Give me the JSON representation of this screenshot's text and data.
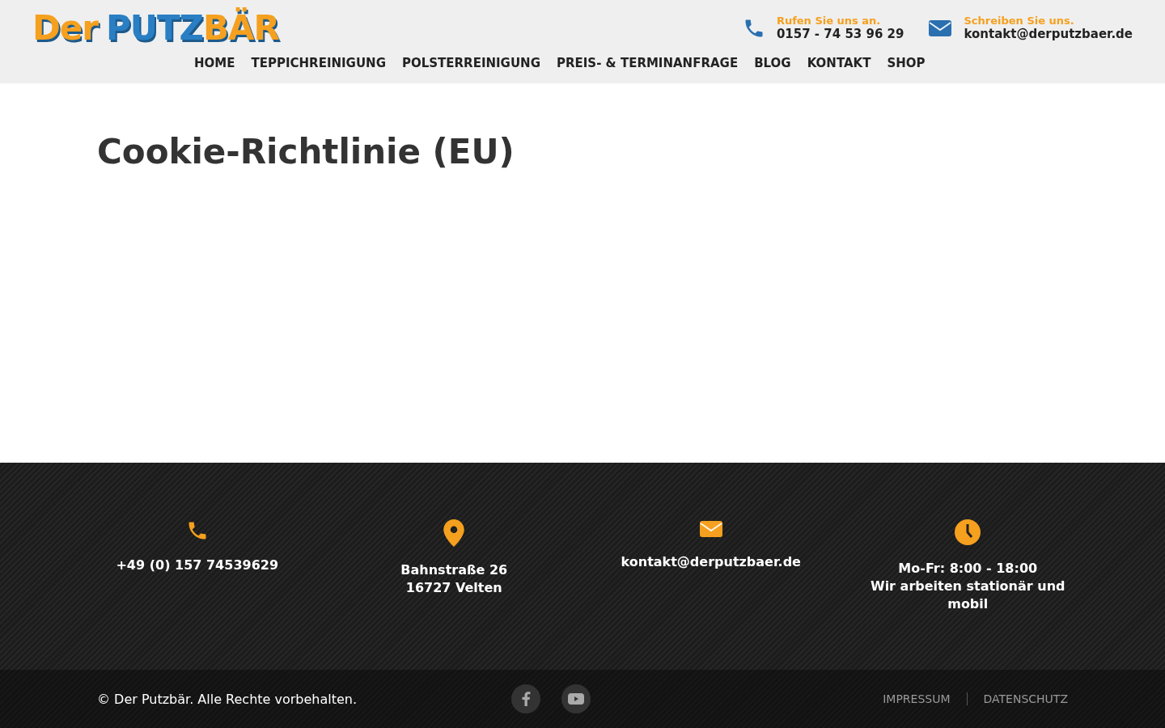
{
  "header": {
    "logo": [
      {
        "text": "Der",
        "color": "#f5a01e"
      },
      {
        "text": "PUTZ",
        "color": "#2a7fc4"
      },
      {
        "text": "BÄR",
        "color": "#f5a01e"
      }
    ],
    "nav": [
      {
        "label": "HOME",
        "selected": false
      },
      {
        "label": "TEPPICHREINIGUNG",
        "selected": false
      },
      {
        "label": "POLSTERREINIGUNG",
        "selected": false
      },
      {
        "label": "PREIS- & TERMINANFRAGE",
        "selected": false
      },
      {
        "label": "BLOG",
        "selected": false
      },
      {
        "label": "KONTAKT",
        "selected": false
      },
      {
        "label": "SHOP",
        "selected": false
      }
    ],
    "contacts": [
      {
        "kind": "phone",
        "caption": "Rufen Sie uns an.",
        "value": "0157 - 74 53 96 29"
      },
      {
        "kind": "mail",
        "caption": "Schreiben Sie uns.",
        "value": "kontakt@derputzbaer.de"
      }
    ]
  },
  "main": {
    "title": "Cookie-Richtlinie (EU)"
  },
  "footer": {
    "columns": [
      {
        "kind": "phone",
        "lines": [
          "+49 (0) 157 74539629"
        ]
      },
      {
        "kind": "pin",
        "lines": [
          "Bahnstraße 26",
          "16727 Velten"
        ]
      },
      {
        "kind": "mail",
        "lines": [
          "kontakt@derputzbaer.de"
        ]
      },
      {
        "kind": "clock",
        "lines": [
          "Mo-Fr: 8:00 - 18:00",
          "Wir arbeiten stationär und mobil"
        ]
      }
    ],
    "copyright": "© Der Putzbär. Alle Rechte vorbehalten.",
    "social": [
      {
        "kind": "facebook"
      },
      {
        "kind": "youtube"
      }
    ],
    "links": [
      "IMPRESSUM",
      "DATENSCHUTZ"
    ]
  }
}
